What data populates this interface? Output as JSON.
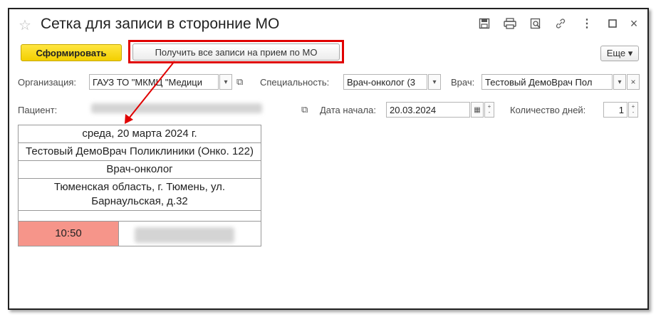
{
  "window": {
    "title": "Сетка для записи в сторонние МО"
  },
  "toolbar": {
    "form_button": "Сформировать",
    "get_all_button": "Получить все записи на прием по МО",
    "more_button": "Еще ▾"
  },
  "filters": {
    "organization_label": "Организация:",
    "organization_value": "ГАУЗ ТО \"МКМЦ \"Медици",
    "specialty_label": "Специальность:",
    "specialty_value": "Врач-онколог (3",
    "doctor_label": "Врач:",
    "doctor_value": "Тестовый ДемоВрач Пол",
    "patient_label": "Пациент:",
    "start_date_label": "Дата начала:",
    "start_date_value": "20.03.2024",
    "days_label": "Количество дней:",
    "days_value": "1"
  },
  "schedule": {
    "date": "среда, 20 марта 2024 г.",
    "doctor": "Тестовый ДемоВрач Поликлиники (Онко. 122)",
    "specialty": "Врач-онколог",
    "address": "Тюменская область, г. Тюмень, ул. Барнаульская, д.32",
    "slots": [
      {
        "time": "10:50"
      }
    ]
  },
  "colors": {
    "accent_yellow": "#f3cf00",
    "highlight_red": "#e00000",
    "busy_slot": "#f6958a"
  }
}
